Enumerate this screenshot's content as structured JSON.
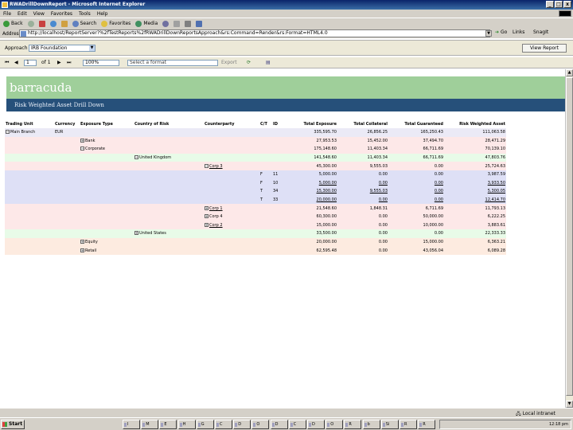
{
  "window": {
    "title": "RWADrillDownReport - Microsoft Internet Explorer",
    "min": "_",
    "max": "□",
    "close": "x"
  },
  "menu": [
    "File",
    "Edit",
    "View",
    "Favorites",
    "Tools",
    "Help"
  ],
  "toolbar": {
    "back": "Back",
    "search": "Search",
    "favorites": "Favorites",
    "media": "Media"
  },
  "address": {
    "label": "Address",
    "url": "http://localhost/ReportServer?%2fTestReports%2fRWADrillDownReportsApproach&rs:Command=Render&rs:Format=HTML4.0",
    "go": "Go",
    "links": "Links",
    "snagit": "SnagIt"
  },
  "params": {
    "label": "Approach",
    "value": "IRB Foundation",
    "view_report": "View Report"
  },
  "report_toolbar": {
    "page": "1",
    "of": "of 1",
    "zoom": "100%",
    "format_placeholder": "Select a format",
    "export": "Export"
  },
  "report": {
    "title": "barracuda",
    "subtitle": "Risk Weighted Asset Drill Down",
    "columns": [
      "Trading Unit",
      "Currency",
      "Exposure Type",
      "Country of Risk",
      "Counterparty",
      "C/T",
      "ID",
      "Total Exposure",
      "Total Collateral",
      "Total Guaranteed",
      "Risk Weighted Asset"
    ],
    "rows": [
      {
        "band": "lav",
        "unit": "Main Branch",
        "tog1": "−",
        "currency": "EUR",
        "exposure": "",
        "country": "",
        "cp": "",
        "ct": "",
        "id": "",
        "te": "335,595.70",
        "tc": "26,856.25",
        "tg": "165,250.43",
        "rwa": "111,063.58"
      },
      {
        "band": "pink",
        "exposure": "Bank",
        "tog2": "+",
        "te": "27,953.53",
        "tc": "15,452.00",
        "tg": "37,494.70",
        "rwa": "28,471.29"
      },
      {
        "band": "pink",
        "exposure": "Corporate",
        "tog2": "−",
        "te": "175,148.60",
        "tc": "11,403.34",
        "tg": "66,711.69",
        "rwa": "70,139.10"
      },
      {
        "band": "green",
        "country": "United Kingdom",
        "tog3": "−",
        "te": "141,548.60",
        "tc": "11,403.34",
        "tg": "66,711.69",
        "rwa": "47,803.76"
      },
      {
        "band": "pink",
        "cp": "Corp 3",
        "tog4": "−",
        "te": "45,300.00",
        "tc": "9,555.03",
        "tg": "0.00",
        "rwa": "25,724.63"
      },
      {
        "band": "blue",
        "ct": "F",
        "id": "11",
        "te": "5,000.00",
        "tc": "0.00",
        "tg": "0.00",
        "rwa": "3,987.59"
      },
      {
        "band": "blue",
        "ct": "F",
        "id": "10",
        "te": "5,000.00",
        "tc": "0.00",
        "tg": "0.00",
        "rwa": "3,933.50",
        "ul": true
      },
      {
        "band": "blue",
        "ct": "T",
        "id": "34",
        "te": "15,300.00",
        "tc": "9,555.03",
        "tg": "0.00",
        "rwa": "5,300.05",
        "ul": true
      },
      {
        "band": "blue",
        "ct": "T",
        "id": "33",
        "te": "20,000.00",
        "tc": "0.00",
        "tg": "0.00",
        "rwa": "12,414.70",
        "ul": true
      },
      {
        "band": "pink",
        "cp": "Corp 1",
        "tog4": "+",
        "te": "21,548.60",
        "tc": "1,848.31",
        "tg": "6,711.69",
        "rwa": "11,793.13"
      },
      {
        "band": "pink",
        "cp": "Corp 4",
        "tog4": "+",
        "link": false,
        "te": "60,300.00",
        "tc": "0.00",
        "tg": "50,000.00",
        "rwa": "6,222.25"
      },
      {
        "band": "pink",
        "cp": "Corp 2",
        "tog4": "+",
        "te": "15,000.00",
        "tc": "0.00",
        "tg": "10,000.00",
        "rwa": "3,883.61"
      },
      {
        "band": "green",
        "country": "United States",
        "tog3": "+",
        "te": "33,500.00",
        "tc": "0.00",
        "tg": "0.00",
        "rwa": "22,333.33"
      },
      {
        "band": "peach",
        "exposure": "Equity",
        "tog2": "+",
        "te": "20,000.00",
        "tc": "0.00",
        "tg": "15,000.00",
        "rwa": "6,363.21"
      },
      {
        "band": "peach",
        "exposure": "Retail",
        "tog2": "+",
        "te": "62,595.48",
        "tc": "0.00",
        "tg": "43,056.04",
        "rwa": "6,089.28"
      }
    ]
  },
  "status": {
    "zone": "Local intranet"
  },
  "taskbar": {
    "start": "Start",
    "buttons": [
      "I",
      "M",
      "E",
      "H",
      "G",
      "C",
      "D",
      "O",
      "D",
      "C",
      "D",
      "O",
      "R",
      "b",
      "Si",
      "R",
      "R"
    ],
    "clock": "12:18 pm"
  },
  "colors": {
    "banner": "#9fcf9a",
    "subbanner": "#26507a"
  }
}
